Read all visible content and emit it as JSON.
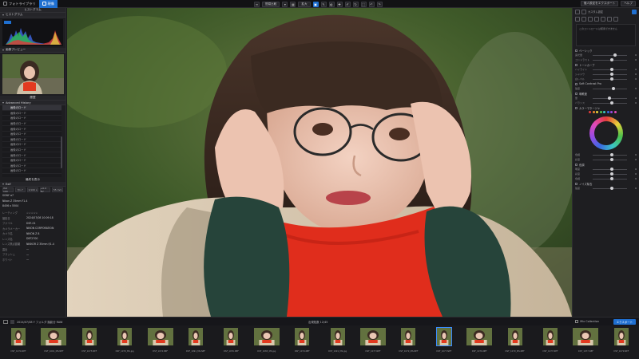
{
  "app": {
    "tabs": [
      {
        "label": "フォトライブラリ",
        "active": false
      },
      {
        "label": "現像",
        "active": true
      }
    ],
    "center_buttons": [
      "簡易比較",
      "拡大"
    ],
    "right_buttons": [
      "個人設定をエクスポート",
      "ヘルプ"
    ]
  },
  "left_panel": {
    "histogram_title": "ヒストグラム",
    "histogram_sub": "ヒストグラム",
    "histogram_readout": "RGB",
    "preview_title": "画像プレビュー",
    "history_header": "履歴",
    "history_title": "Advanced History",
    "history_items": [
      "画像のロード",
      "画像のロード",
      "画像のロード",
      "画像のロード",
      "画像のロード",
      "画像のロード",
      "画像のロード",
      "画像のロード",
      "画像のロード",
      "画像のロード",
      "画像のロード",
      "画像のロード",
      "画像のロード"
    ],
    "history_footer": "最終を表示",
    "exif_title": "Exif",
    "exif_buttons": [
      "ISO 100",
      "f/1.7",
      "1/100 s",
      "+0.0 EV",
      "55 mm"
    ],
    "info_rows": [
      {
        "k": "SONY α7",
        "v": ""
      },
      {
        "k": "Nikon Z 35mm F1.4",
        "v": ""
      },
      {
        "k": "8456 x 5504",
        "v": ""
      }
    ],
    "meta_rows": [
      {
        "k": "レーティング",
        "v": "☆☆☆☆☆"
      },
      {
        "k": "撮影日",
        "v": "2024/07/08 10:09:18"
      },
      {
        "k": "ファイル",
        "v": "DSF-01"
      },
      {
        "k": "カメラメーカー",
        "v": "NIKON CORPORATION"
      },
      {
        "k": "カメラ名",
        "v": "NIKON Z 8"
      },
      {
        "k": "レンズ名",
        "v": "DEF2700"
      },
      {
        "k": "レンズ焦点距離",
        "v": "NIKKOR Z 35mm f/1.4"
      },
      {
        "k": "露出",
        "v": "—"
      },
      {
        "k": "フラッシュ",
        "v": "—"
      },
      {
        "k": "ホワイト",
        "v": "—"
      }
    ]
  },
  "right_panel": {
    "top_label": "カスタム設定",
    "notice": "このコントロールは使用できません",
    "groups": [
      {
        "label": "ベーシック",
        "sliders": [
          {
            "l": "露光量",
            "v": "0"
          },
          {
            "l": "コントラスト",
            "v": "0"
          }
        ]
      },
      {
        "label": "トーンカーブ",
        "sliders": [
          {
            "l": "ハイライト",
            "v": "0"
          },
          {
            "l": "シャドウ",
            "v": "0"
          },
          {
            "l": "白レベル",
            "v": "0"
          }
        ]
      },
      {
        "label": "Soft Contrast Pro",
        "sliders": [
          {
            "l": "強度",
            "v": "0"
          }
        ]
      },
      {
        "label": "明瞭度",
        "sliders": [
          {
            "l": "量",
            "v": "0"
          },
          {
            "l": "バランス",
            "v": "0"
          }
        ]
      },
      {
        "label": "カラーマネージャ",
        "sliders": [
          {
            "l": "色相",
            "v": "0"
          },
          {
            "l": "彩度",
            "v": "0"
          }
        ]
      },
      {
        "label": "色調",
        "sliders": [
          {
            "l": "明度",
            "v": "0"
          },
          {
            "l": "彩度",
            "v": "0"
          },
          {
            "l": "色相",
            "v": "0"
          }
        ]
      },
      {
        "label": "ノイズ除去",
        "sliders": [
          {
            "l": "強度",
            "v": "0"
          }
        ]
      }
    ],
    "colorwheel_label": "カラーホイール"
  },
  "filmbar": {
    "path": "2024/07/08 Y フォルダ 撮影分 RAW",
    "count": "出現枚数 12/45",
    "collection": "Mix Collection",
    "export_label": "エクスポート"
  },
  "thumbs": [
    {
      "name": "DSF_1074.NEF",
      "sel": false
    },
    {
      "name": "DSF_1091_MS.NEF",
      "sel": false
    },
    {
      "name": "DSF_1075.NEF",
      "sel": false
    },
    {
      "name": "DSF_1079_MS.jpg",
      "sel": false
    },
    {
      "name": "DSF_1074.NEF",
      "sel": false
    },
    {
      "name": "DSF_1091_MS.NEF",
      "sel": false
    },
    {
      "name": "DSF_1076.NEF",
      "sel": false
    },
    {
      "name": "DSF_1083_MS.jpg",
      "sel": false
    },
    {
      "name": "DSF_1074.NEF",
      "sel": false
    },
    {
      "name": "DSF_1091_MS.jpg",
      "sel": false
    },
    {
      "name": "DSF_1077.NEF",
      "sel": false
    },
    {
      "name": "DSF_1079_MS.NEF",
      "sel": false
    },
    {
      "name": "DSF_1077.NEF",
      "sel": true
    },
    {
      "name": "DSF_1076.NEF",
      "sel": false
    },
    {
      "name": "DSF_1079_MS.NEF",
      "sel": false
    },
    {
      "name": "DSF_1077.NEF",
      "sel": false
    },
    {
      "name": "DSF_1077.NEF",
      "sel": false
    },
    {
      "name": "DSF_1079.NEF",
      "sel": false
    }
  ]
}
